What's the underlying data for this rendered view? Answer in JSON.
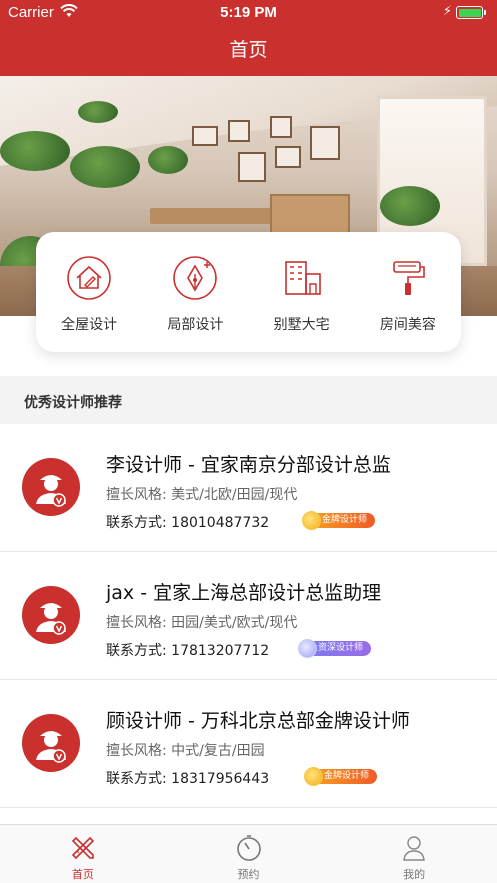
{
  "status_bar": {
    "carrier": "Carrier",
    "time": "5:19 PM"
  },
  "nav": {
    "title": "首页"
  },
  "categories": [
    {
      "label": "全屋设计",
      "icon": "house-design-icon"
    },
    {
      "label": "局部设计",
      "icon": "pen-nib-icon"
    },
    {
      "label": "别墅大宅",
      "icon": "villa-building-icon"
    },
    {
      "label": "房间美容",
      "icon": "paint-roller-icon"
    }
  ],
  "section": {
    "title": "优秀设计师推荐"
  },
  "designers": [
    {
      "name": "李设计师 - 宜家南京分部设计总监",
      "style": "擅长风格: 美式/北欧/田园/现代",
      "contact": "联系方式: 18010487732",
      "badge": "金牌设计师",
      "badge_type": "gold"
    },
    {
      "name": "jax - 宜家上海总部设计总监助理",
      "style": "擅长风格: 田园/美式/欧式/现代",
      "contact": "联系方式: 17813207712",
      "badge": "资深设计师",
      "badge_type": "senior"
    },
    {
      "name": "顾设计师 - 万科北京总部金牌设计师",
      "style": "擅长风格: 中式/复古/田园",
      "contact": "联系方式: 18317956443",
      "badge": "金牌设计师",
      "badge_type": "gold"
    }
  ],
  "tabs": [
    {
      "label": "首页",
      "icon": "pencil-ruler-icon",
      "active": true
    },
    {
      "label": "预约",
      "icon": "timer-icon",
      "active": false
    },
    {
      "label": "我的",
      "icon": "user-icon",
      "active": false
    }
  ],
  "colors": {
    "brand_red": "#c9302e",
    "gold_badge": "#f05a28",
    "senior_badge": "#8b6fe9"
  }
}
